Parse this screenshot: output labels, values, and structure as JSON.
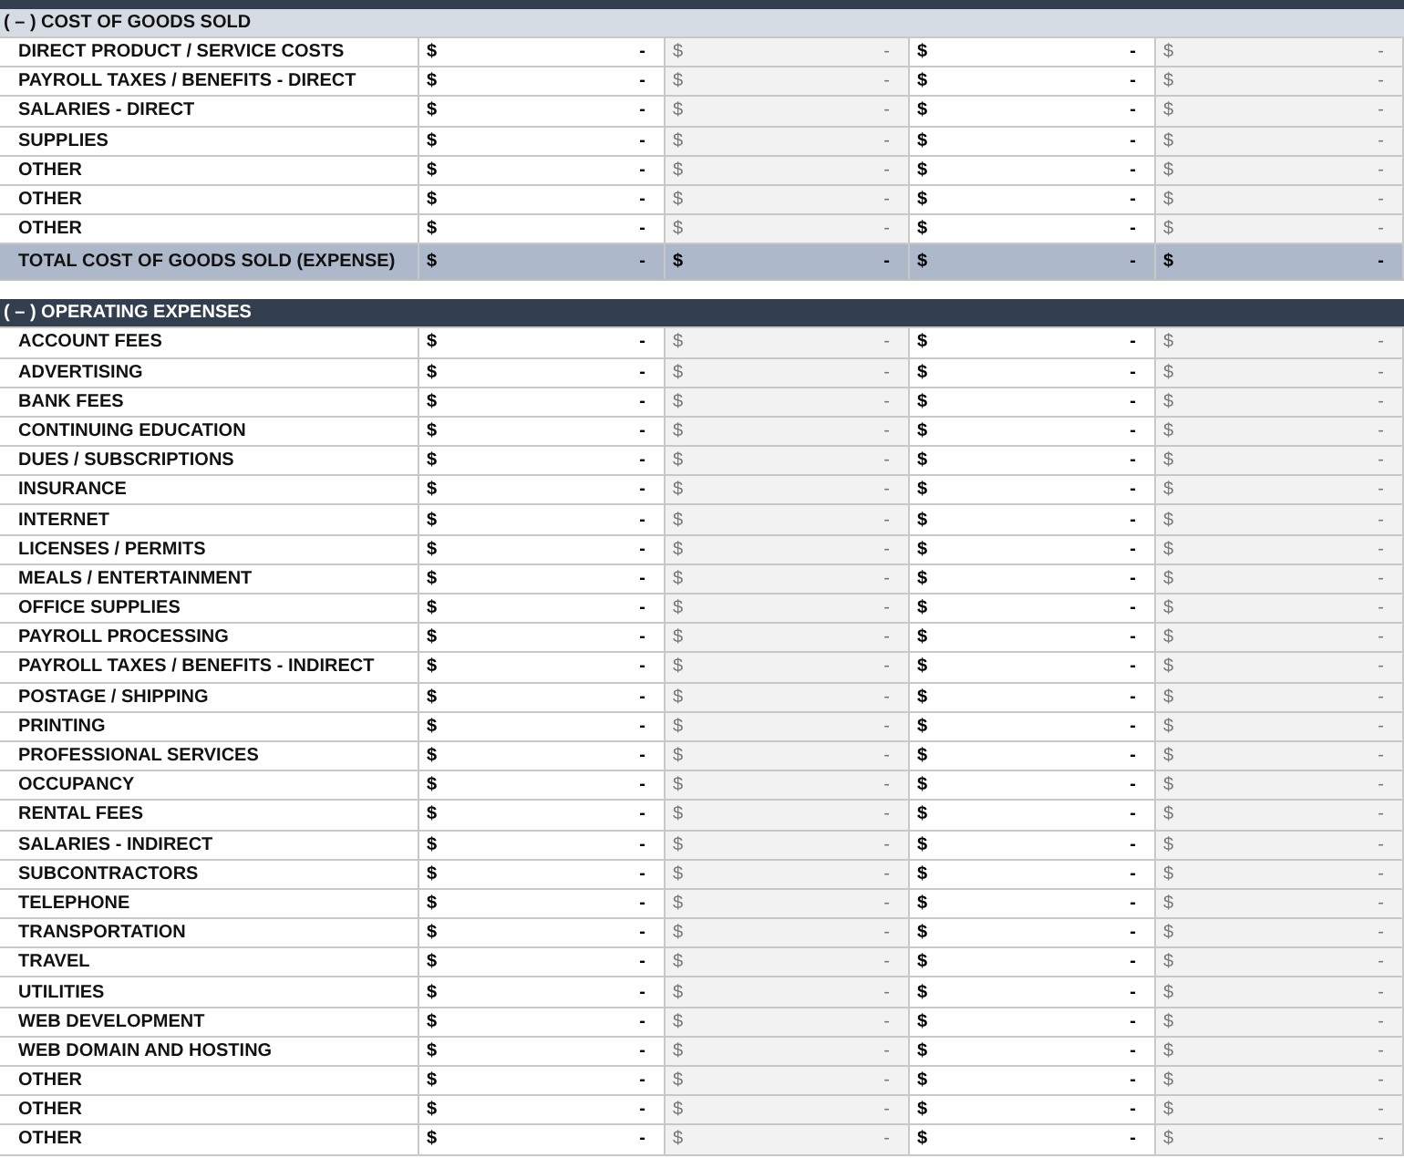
{
  "sections": [
    {
      "kind": "light",
      "title": "( – ) COST OF GOODS SOLD",
      "rows": [
        {
          "label": "DIRECT PRODUCT / SERVICE COSTS",
          "cells": [
            [
              "$",
              "-"
            ],
            [
              "$",
              "-"
            ],
            [
              "$",
              "-"
            ],
            [
              "$",
              "-"
            ]
          ]
        },
        {
          "label": "PAYROLL TAXES / BENEFITS - DIRECT",
          "cells": [
            [
              "$",
              "-"
            ],
            [
              "$",
              "-"
            ],
            [
              "$",
              "-"
            ],
            [
              "$",
              "-"
            ]
          ]
        },
        {
          "label": "SALARIES - DIRECT",
          "cells": [
            [
              "$",
              "-"
            ],
            [
              "$",
              "-"
            ],
            [
              "$",
              "-"
            ],
            [
              "$",
              "-"
            ]
          ]
        },
        {
          "label": "SUPPLIES",
          "cells": [
            [
              "$",
              "-"
            ],
            [
              "$",
              "-"
            ],
            [
              "$",
              "-"
            ],
            [
              "$",
              "-"
            ]
          ]
        },
        {
          "label": "OTHER",
          "cells": [
            [
              "$",
              "-"
            ],
            [
              "$",
              "-"
            ],
            [
              "$",
              "-"
            ],
            [
              "$",
              "-"
            ]
          ]
        },
        {
          "label": "OTHER",
          "cells": [
            [
              "$",
              "-"
            ],
            [
              "$",
              "-"
            ],
            [
              "$",
              "-"
            ],
            [
              "$",
              "-"
            ]
          ]
        },
        {
          "label": "OTHER",
          "cells": [
            [
              "$",
              "-"
            ],
            [
              "$",
              "-"
            ],
            [
              "$",
              "-"
            ],
            [
              "$",
              "-"
            ]
          ]
        }
      ],
      "total": {
        "label": "TOTAL COST OF GOODS SOLD (EXPENSE)",
        "cells": [
          [
            "$",
            "-"
          ],
          [
            "$",
            "-"
          ],
          [
            "$",
            "-"
          ],
          [
            "$",
            "-"
          ]
        ]
      }
    },
    {
      "kind": "dark",
      "title": "( – ) OPERATING EXPENSES",
      "rows": [
        {
          "label": "ACCOUNT FEES",
          "cells": [
            [
              "$",
              "-"
            ],
            [
              "$",
              "-"
            ],
            [
              "$",
              "-"
            ],
            [
              "$",
              "-"
            ]
          ]
        },
        {
          "label": "ADVERTISING",
          "cells": [
            [
              "$",
              "-"
            ],
            [
              "$",
              "-"
            ],
            [
              "$",
              "-"
            ],
            [
              "$",
              "-"
            ]
          ]
        },
        {
          "label": "BANK FEES",
          "cells": [
            [
              "$",
              "-"
            ],
            [
              "$",
              "-"
            ],
            [
              "$",
              "-"
            ],
            [
              "$",
              "-"
            ]
          ]
        },
        {
          "label": "CONTINUING EDUCATION",
          "cells": [
            [
              "$",
              "-"
            ],
            [
              "$",
              "-"
            ],
            [
              "$",
              "-"
            ],
            [
              "$",
              "-"
            ]
          ]
        },
        {
          "label": "DUES / SUBSCRIPTIONS",
          "cells": [
            [
              "$",
              "-"
            ],
            [
              "$",
              "-"
            ],
            [
              "$",
              "-"
            ],
            [
              "$",
              "-"
            ]
          ]
        },
        {
          "label": "INSURANCE",
          "cells": [
            [
              "$",
              "-"
            ],
            [
              "$",
              "-"
            ],
            [
              "$",
              "-"
            ],
            [
              "$",
              "-"
            ]
          ]
        },
        {
          "label": "INTERNET",
          "cells": [
            [
              "$",
              "-"
            ],
            [
              "$",
              "-"
            ],
            [
              "$",
              "-"
            ],
            [
              "$",
              "-"
            ]
          ]
        },
        {
          "label": "LICENSES / PERMITS",
          "cells": [
            [
              "$",
              "-"
            ],
            [
              "$",
              "-"
            ],
            [
              "$",
              "-"
            ],
            [
              "$",
              "-"
            ]
          ]
        },
        {
          "label": "MEALS / ENTERTAINMENT",
          "cells": [
            [
              "$",
              "-"
            ],
            [
              "$",
              "-"
            ],
            [
              "$",
              "-"
            ],
            [
              "$",
              "-"
            ]
          ]
        },
        {
          "label": "OFFICE SUPPLIES",
          "cells": [
            [
              "$",
              "-"
            ],
            [
              "$",
              "-"
            ],
            [
              "$",
              "-"
            ],
            [
              "$",
              "-"
            ]
          ]
        },
        {
          "label": "PAYROLL PROCESSING",
          "cells": [
            [
              "$",
              "-"
            ],
            [
              "$",
              "-"
            ],
            [
              "$",
              "-"
            ],
            [
              "$",
              "-"
            ]
          ]
        },
        {
          "label": "PAYROLL TAXES / BENEFITS - INDIRECT",
          "cells": [
            [
              "$",
              "-"
            ],
            [
              "$",
              "-"
            ],
            [
              "$",
              "-"
            ],
            [
              "$",
              "-"
            ]
          ]
        },
        {
          "label": "POSTAGE / SHIPPING",
          "cells": [
            [
              "$",
              "-"
            ],
            [
              "$",
              "-"
            ],
            [
              "$",
              "-"
            ],
            [
              "$",
              "-"
            ]
          ]
        },
        {
          "label": "PRINTING",
          "cells": [
            [
              "$",
              "-"
            ],
            [
              "$",
              "-"
            ],
            [
              "$",
              "-"
            ],
            [
              "$",
              "-"
            ]
          ]
        },
        {
          "label": "PROFESSIONAL SERVICES",
          "cells": [
            [
              "$",
              "-"
            ],
            [
              "$",
              "-"
            ],
            [
              "$",
              "-"
            ],
            [
              "$",
              "-"
            ]
          ]
        },
        {
          "label": "OCCUPANCY",
          "cells": [
            [
              "$",
              "-"
            ],
            [
              "$",
              "-"
            ],
            [
              "$",
              "-"
            ],
            [
              "$",
              "-"
            ]
          ]
        },
        {
          "label": "RENTAL FEES",
          "cells": [
            [
              "$",
              "-"
            ],
            [
              "$",
              "-"
            ],
            [
              "$",
              "-"
            ],
            [
              "$",
              "-"
            ]
          ]
        },
        {
          "label": "SALARIES - INDIRECT",
          "cells": [
            [
              "$",
              "-"
            ],
            [
              "$",
              "-"
            ],
            [
              "$",
              "-"
            ],
            [
              "$",
              "-"
            ]
          ]
        },
        {
          "label": "SUBCONTRACTORS",
          "cells": [
            [
              "$",
              "-"
            ],
            [
              "$",
              "-"
            ],
            [
              "$",
              "-"
            ],
            [
              "$",
              "-"
            ]
          ]
        },
        {
          "label": "TELEPHONE",
          "cells": [
            [
              "$",
              "-"
            ],
            [
              "$",
              "-"
            ],
            [
              "$",
              "-"
            ],
            [
              "$",
              "-"
            ]
          ]
        },
        {
          "label": "TRANSPORTATION",
          "cells": [
            [
              "$",
              "-"
            ],
            [
              "$",
              "-"
            ],
            [
              "$",
              "-"
            ],
            [
              "$",
              "-"
            ]
          ]
        },
        {
          "label": "TRAVEL",
          "cells": [
            [
              "$",
              "-"
            ],
            [
              "$",
              "-"
            ],
            [
              "$",
              "-"
            ],
            [
              "$",
              "-"
            ]
          ]
        },
        {
          "label": "UTILITIES",
          "cells": [
            [
              "$",
              "-"
            ],
            [
              "$",
              "-"
            ],
            [
              "$",
              "-"
            ],
            [
              "$",
              "-"
            ]
          ]
        },
        {
          "label": "WEB DEVELOPMENT",
          "cells": [
            [
              "$",
              "-"
            ],
            [
              "$",
              "-"
            ],
            [
              "$",
              "-"
            ],
            [
              "$",
              "-"
            ]
          ]
        },
        {
          "label": "WEB DOMAIN AND HOSTING",
          "cells": [
            [
              "$",
              "-"
            ],
            [
              "$",
              "-"
            ],
            [
              "$",
              "-"
            ],
            [
              "$",
              "-"
            ]
          ]
        },
        {
          "label": "OTHER",
          "cells": [
            [
              "$",
              "-"
            ],
            [
              "$",
              "-"
            ],
            [
              "$",
              "-"
            ],
            [
              "$",
              "-"
            ]
          ]
        },
        {
          "label": "OTHER",
          "cells": [
            [
              "$",
              "-"
            ],
            [
              "$",
              "-"
            ],
            [
              "$",
              "-"
            ],
            [
              "$",
              "-"
            ]
          ]
        },
        {
          "label": "OTHER",
          "cells": [
            [
              "$",
              "-"
            ],
            [
              "$",
              "-"
            ],
            [
              "$",
              "-"
            ],
            [
              "$",
              "-"
            ]
          ]
        }
      ]
    }
  ]
}
